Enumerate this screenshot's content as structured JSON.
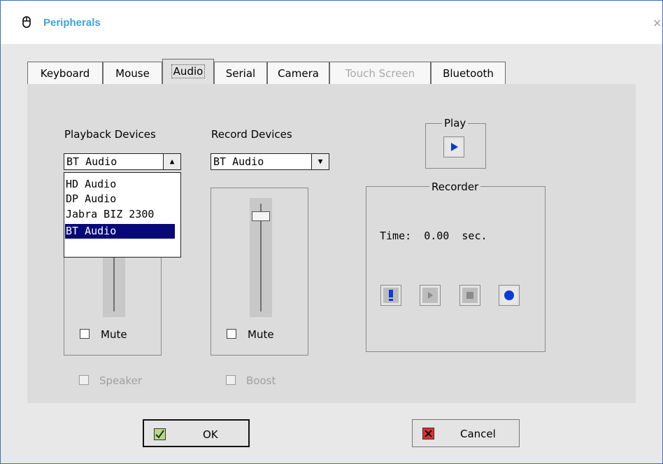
{
  "window": {
    "title": "Peripherals",
    "title_icon": "mouse-icon",
    "close_glyph": "×",
    "colors": {
      "title": "#3fa3df",
      "border": "#3a6fc0",
      "selection": "#080878"
    }
  },
  "tabs": [
    {
      "label": "Keyboard",
      "state": "normal"
    },
    {
      "label": "Mouse",
      "state": "normal"
    },
    {
      "label": "Audio",
      "state": "active"
    },
    {
      "label": "Serial",
      "state": "normal"
    },
    {
      "label": "Camera",
      "state": "normal"
    },
    {
      "label": "Touch Screen",
      "state": "disabled"
    },
    {
      "label": "Bluetooth",
      "state": "normal"
    }
  ],
  "playback": {
    "label": "Playback Devices",
    "selected": "BT Audio",
    "arrow": "▲",
    "options": [
      "HD Audio",
      "DP Audio",
      "Jabra BIZ 2300",
      "BT Audio"
    ],
    "mute_label": "Mute",
    "mute_checked": false,
    "speaker_label": "Speaker",
    "speaker_enabled": false
  },
  "record": {
    "label": "Record Devices",
    "selected": "BT Audio",
    "arrow": "▼",
    "mute_label": "Mute",
    "mute_checked": false,
    "boost_label": "Boost",
    "boost_enabled": false
  },
  "play": {
    "legend": "Play",
    "button_icon": "play-icon"
  },
  "recorder": {
    "legend": "Recorder",
    "time_label": "Time:",
    "time_value": "0.00",
    "time_unit": "sec.",
    "buttons": [
      "exclamation-icon",
      "play-icon",
      "stop-icon",
      "record-icon"
    ]
  },
  "footer": {
    "ok_label": "OK",
    "cancel_label": "Cancel"
  }
}
